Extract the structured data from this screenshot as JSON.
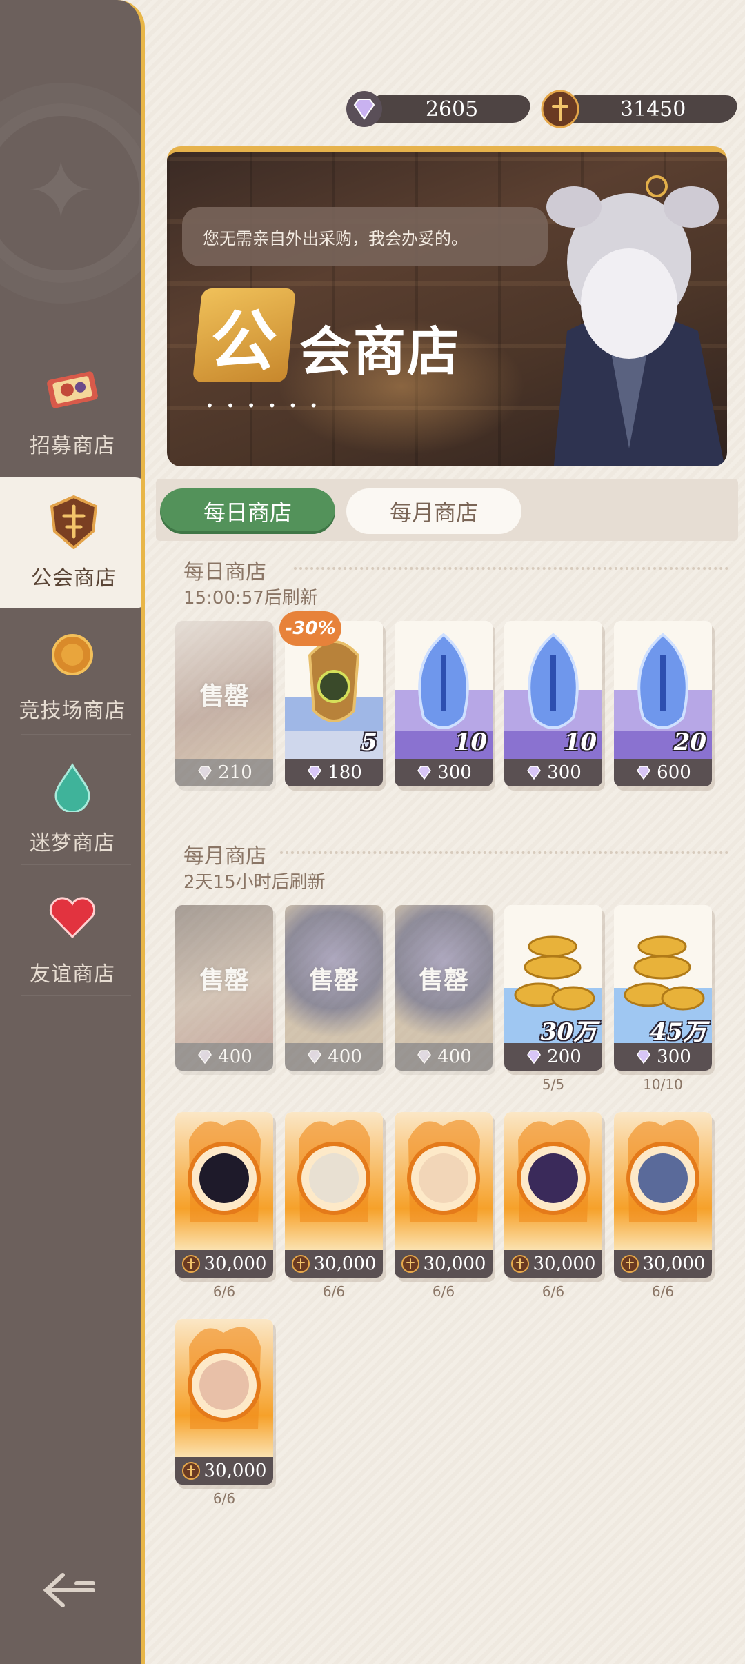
{
  "colors": {
    "sidebar": "#6c605c",
    "accent_gold": "#e8b648",
    "tab_active": "#53925a",
    "price_bar": "#5a5052",
    "discount": "#e7823a"
  },
  "currency": {
    "gems": "2605",
    "guild_coins": "31450",
    "gem_icon": "diamond-icon",
    "guild_coin_icon": "guild-coin-icon"
  },
  "sidebar": {
    "items": [
      {
        "label": "招募商店",
        "icon": "recruit-ticket-icon"
      },
      {
        "label": "公会商店",
        "icon": "guild-shield-icon"
      },
      {
        "label": "竞技场商店",
        "icon": "arena-medal-icon"
      },
      {
        "label": "迷梦商店",
        "icon": "dream-drop-icon"
      },
      {
        "label": "友谊商店",
        "icon": "heart-icon"
      }
    ],
    "back_icon": "back-arrow-icon"
  },
  "banner": {
    "speech": "您无需亲自外出采购，我会办妥的。",
    "title_first": "公",
    "title_rest": "会商店"
  },
  "tabs": {
    "daily": "每日商店",
    "monthly": "每月商店"
  },
  "daily": {
    "title": "每日商店",
    "refresh": "15:00:57后刷新",
    "items": [
      {
        "sold": true,
        "sold_label": "售罄",
        "price": "210",
        "currency": "gem"
      },
      {
        "sold": false,
        "qty": "5",
        "price": "180",
        "currency": "gem",
        "discount": "-30%"
      },
      {
        "sold": false,
        "qty": "10",
        "price": "300",
        "currency": "gem"
      },
      {
        "sold": false,
        "qty": "10",
        "price": "300",
        "currency": "gem"
      },
      {
        "sold": false,
        "qty": "20",
        "price": "600",
        "currency": "gem"
      }
    ]
  },
  "monthly": {
    "title": "每月商店",
    "refresh": "2天15小时后刷新",
    "items": [
      {
        "sold": true,
        "sold_label": "售罄",
        "price": "400",
        "currency": "gem"
      },
      {
        "sold": true,
        "sold_label": "售罄",
        "price": "400",
        "currency": "gem"
      },
      {
        "sold": true,
        "sold_label": "售罄",
        "price": "400",
        "currency": "gem"
      },
      {
        "sold": false,
        "qty": "30万",
        "price": "200",
        "currency": "gem",
        "limit": "5/5"
      },
      {
        "sold": false,
        "qty": "45万",
        "price": "300",
        "currency": "gem",
        "limit": "10/10"
      },
      {
        "sold": false,
        "price": "30,000",
        "currency": "guild",
        "limit": "6/6"
      },
      {
        "sold": false,
        "price": "30,000",
        "currency": "guild",
        "limit": "6/6"
      },
      {
        "sold": false,
        "price": "30,000",
        "currency": "guild",
        "limit": "6/6"
      },
      {
        "sold": false,
        "price": "30,000",
        "currency": "guild",
        "limit": "6/6"
      },
      {
        "sold": false,
        "price": "30,000",
        "currency": "guild",
        "limit": "6/6"
      },
      {
        "sold": false,
        "price": "30,000",
        "currency": "guild",
        "limit": "6/6"
      }
    ]
  }
}
